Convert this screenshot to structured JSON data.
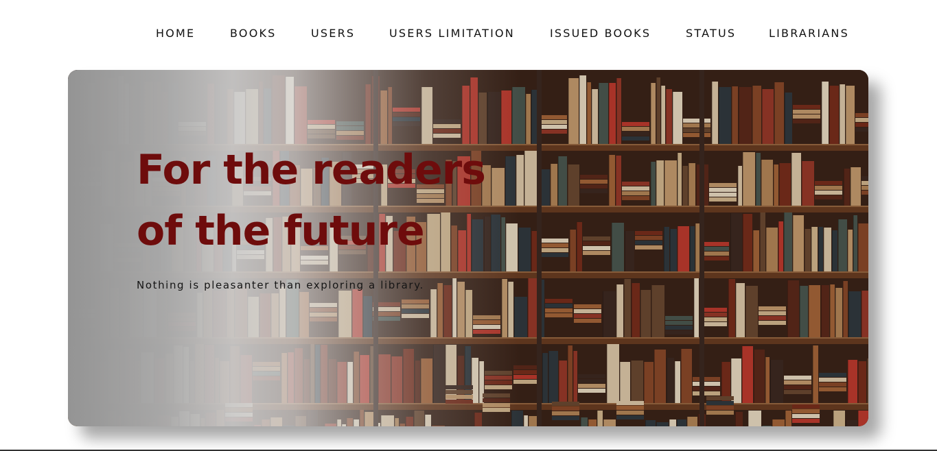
{
  "nav": {
    "items": [
      {
        "label": "HOME"
      },
      {
        "label": "BOOKS"
      },
      {
        "label": "USERS"
      },
      {
        "label": "USERS LIMITATION"
      },
      {
        "label": "ISSUED BOOKS"
      },
      {
        "label": "STATUS"
      },
      {
        "label": "LIBRARIANS"
      }
    ]
  },
  "hero": {
    "title_line1": "For the readers",
    "title_line2": "of the future",
    "subtitle": "Nothing is pleasanter than exploring a library.",
    "image": "bookshelf-photo",
    "title_color": "#6e0c0c"
  }
}
